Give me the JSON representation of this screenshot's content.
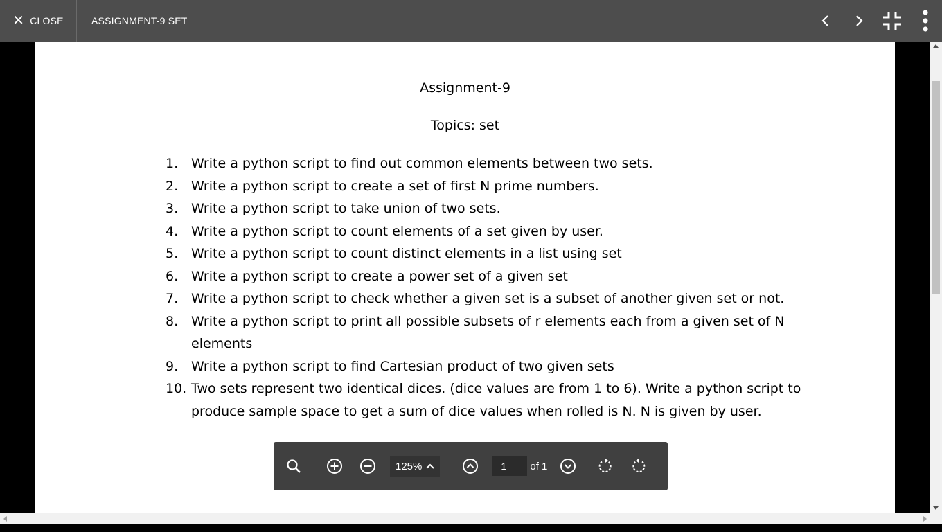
{
  "topbar": {
    "close_label": "CLOSE",
    "title": "ASSIGNMENT-9 SET",
    "icons": [
      "close-icon",
      "chevron-left-icon",
      "chevron-right-icon",
      "exit-fullscreen-icon",
      "more-vert-icon"
    ]
  },
  "document": {
    "title": "Assignment-9",
    "topics": "Topics: set",
    "questions": [
      {
        "num": "1.",
        "text": "Write a python script to find out common elements between two sets."
      },
      {
        "num": "2.",
        "text": "Write a python script to create a set of first N prime numbers."
      },
      {
        "num": "3.",
        "text": "Write a python script to take union of two sets."
      },
      {
        "num": "4.",
        "text": "Write a python script to count elements of a set given by user."
      },
      {
        "num": "5.",
        "text": "Write a python script to count distinct elements in a list using set"
      },
      {
        "num": "6.",
        "text": "Write a python script to create a power set of a given set"
      },
      {
        "num": "7.",
        "text": "Write a python script to check whether a given set is a subset of another given set or not."
      },
      {
        "num": "8.",
        "text": "Write a python script to print all possible subsets of r elements each from a given set of N elements"
      },
      {
        "num": "9.",
        "text": "Write a python script to find Cartesian product of two given sets"
      },
      {
        "num": "10.",
        "text": "Two sets represent two identical dices. (dice values are from 1 to 6). Write a python script to produce sample space to get a sum of dice values when rolled is N. N is given by user."
      }
    ]
  },
  "toolbar": {
    "zoom": "125%",
    "page_value": "1",
    "page_total": "of 1"
  },
  "colors": {
    "topbar_bg": "#4d4d4d",
    "toolbar_bg": "#404040",
    "page_bg": "#ffffff"
  }
}
